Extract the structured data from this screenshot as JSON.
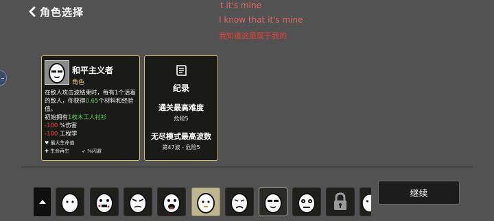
{
  "header": {
    "title": "角色选择"
  },
  "overlay_lyrics": [
    "t it's mine",
    "I know that it's mine",
    "我知道这是属于我的"
  ],
  "character": {
    "name": "和平主义者",
    "role": "角色",
    "desc_1": "在敌人攻击波结束时，每有1个活着的敌人，你获得",
    "desc_green": "0.65",
    "desc_2": "个材料和经验值。",
    "start_prefix": "初始拥有",
    "start_item": "1枚木工人衬衫",
    "stat1_value": "-100",
    "stat1_label": "%伤害",
    "stat2_value": "-100",
    "stat2_label": "工程学",
    "mini_hp": "最大生命值",
    "mini_regen": "生命再生",
    "mini_dodge": "%闪避"
  },
  "record": {
    "title": "纪录",
    "best_difficulty_label": "通关最高难度",
    "best_difficulty_value": "危险5",
    "endless_label": "无尽模式最高波数",
    "endless_value": "第47波 - 危险5"
  },
  "character_slots": [
    {
      "icon": "egg-plain-icon",
      "state": "normal"
    },
    {
      "icon": "egg-spotted-icon",
      "state": "normal"
    },
    {
      "icon": "egg-angry-icon",
      "state": "normal"
    },
    {
      "icon": "egg-shout-icon",
      "state": "normal"
    },
    {
      "icon": "egg-calm-icon",
      "state": "selected"
    },
    {
      "icon": "egg-sad-icon",
      "state": "normal"
    },
    {
      "icon": "egg-pacifist-icon",
      "state": "highlight"
    },
    {
      "icon": "egg-mummy-icon",
      "state": "normal"
    },
    {
      "icon": "lock-icon",
      "state": "normal"
    },
    {
      "icon": "egg-partial-icon",
      "state": "normal"
    }
  ],
  "continue_label": "继续"
}
